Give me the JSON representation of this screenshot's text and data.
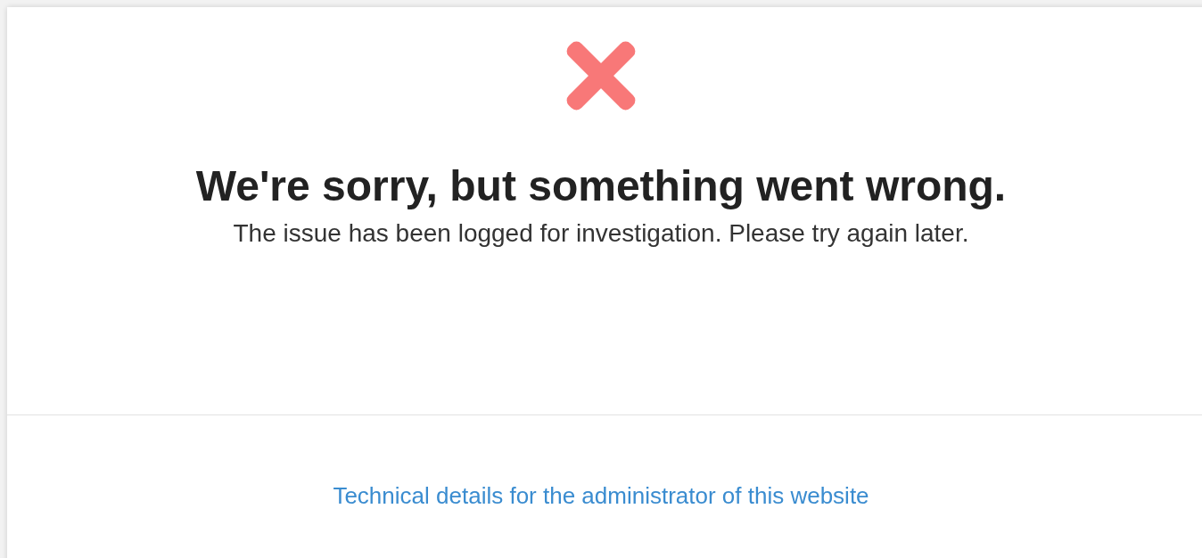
{
  "error": {
    "title": "We're sorry, but something went wrong.",
    "message": "The issue has been logged for investigation. Please try again later."
  },
  "footer": {
    "link": "Technical details for the administrator of this website"
  }
}
